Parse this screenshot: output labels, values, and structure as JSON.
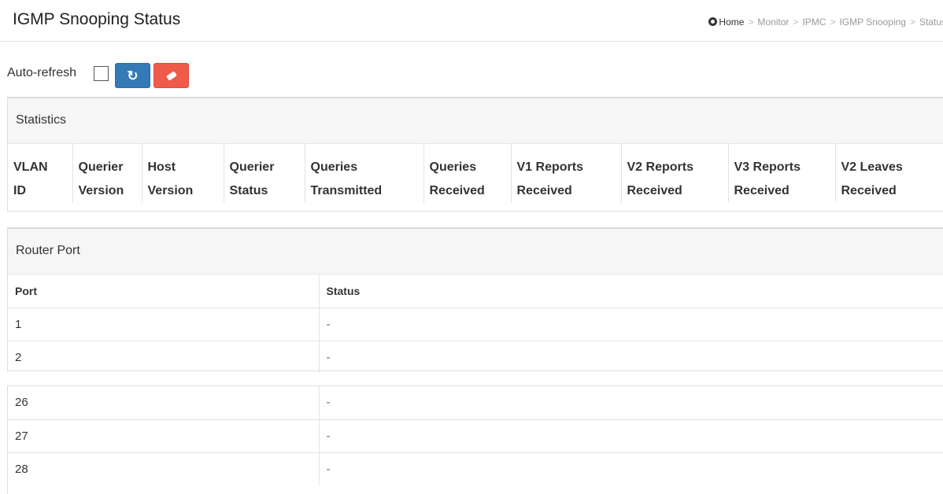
{
  "header": {
    "title": "IGMP Snooping Status",
    "breadcrumb": [
      "Home",
      "Monitor",
      "IPMC",
      "IGMP Snooping",
      "Status"
    ]
  },
  "toolbar": {
    "auto_refresh_label": "Auto-refresh",
    "auto_refresh_checked": false,
    "refresh_icon": "refresh-icon",
    "clear_icon": "eraser-icon",
    "refresh_color": "#337ab7",
    "clear_color": "#f05a49"
  },
  "statistics": {
    "heading": "Statistics",
    "columns": [
      [
        "VLAN",
        "ID"
      ],
      [
        "Querier",
        "Version"
      ],
      [
        "Host",
        "Version"
      ],
      [
        "Querier",
        "Status"
      ],
      [
        "Queries",
        "Transmitted"
      ],
      [
        "Queries",
        "Received"
      ],
      [
        "V1 Reports",
        "Received"
      ],
      [
        "V2 Reports",
        "Received"
      ],
      [
        "V3 Reports",
        "Received"
      ],
      [
        "V2 Leaves",
        "Received"
      ]
    ]
  },
  "router_port": {
    "heading": "Router Port",
    "col_port": "Port",
    "col_status": "Status",
    "rows": [
      {
        "port": "1",
        "status": "-"
      },
      {
        "port": "2",
        "status": "-"
      }
    ],
    "rows_continued": [
      {
        "port": "26",
        "status": "-"
      },
      {
        "port": "27",
        "status": "-"
      },
      {
        "port": "28",
        "status": "-"
      }
    ]
  }
}
